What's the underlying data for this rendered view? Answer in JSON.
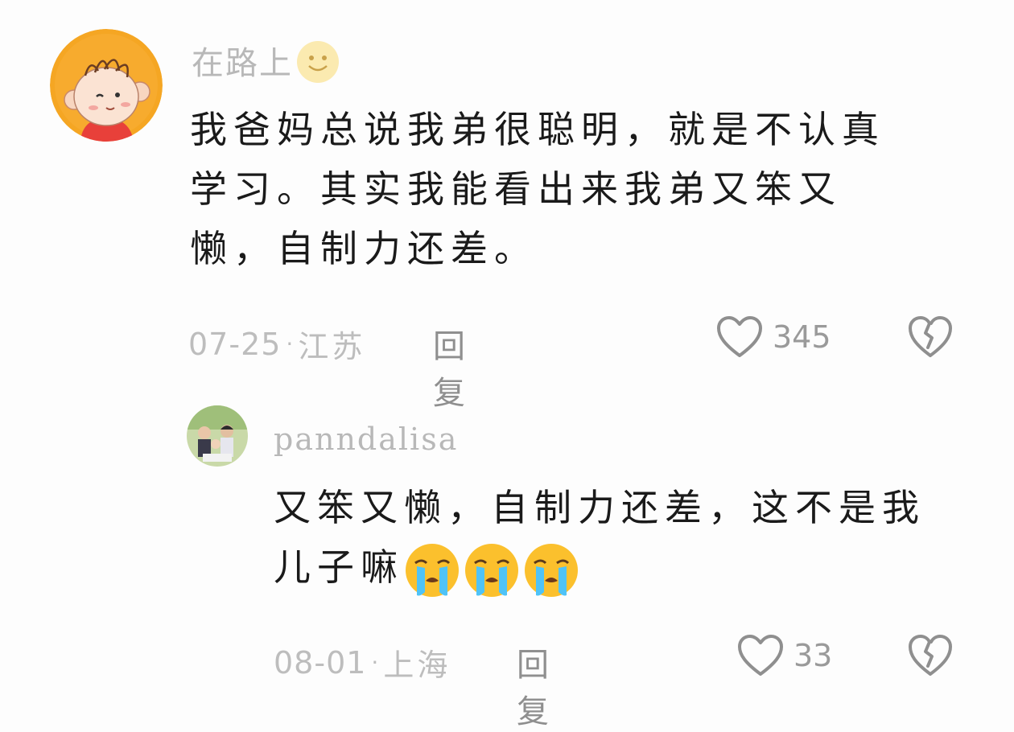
{
  "comments": [
    {
      "username": "在路上",
      "username_emoji": "smile-emoji",
      "text_lines": [
        "我爸妈总说我弟很聪明，就是不认真",
        "学习。其实我能看出来我弟又笨又",
        "懒，自制力还差。"
      ],
      "date": "07-25",
      "location": "江苏",
      "reply_label": "回复",
      "like_count": "345"
    },
    {
      "username": "panndalisa",
      "text_lines": [
        "又笨又懒，自制力还差，这不是我",
        "儿子嘛"
      ],
      "trailing_emoji": [
        "crying-emoji",
        "crying-emoji",
        "crying-emoji"
      ],
      "date": "08-01",
      "location": "上海",
      "reply_label": "回复",
      "like_count": "33"
    }
  ],
  "colors": {
    "muted_text": "#bdbdbd",
    "body_text": "#1a1a1a",
    "icon": "#8f8f8f"
  }
}
